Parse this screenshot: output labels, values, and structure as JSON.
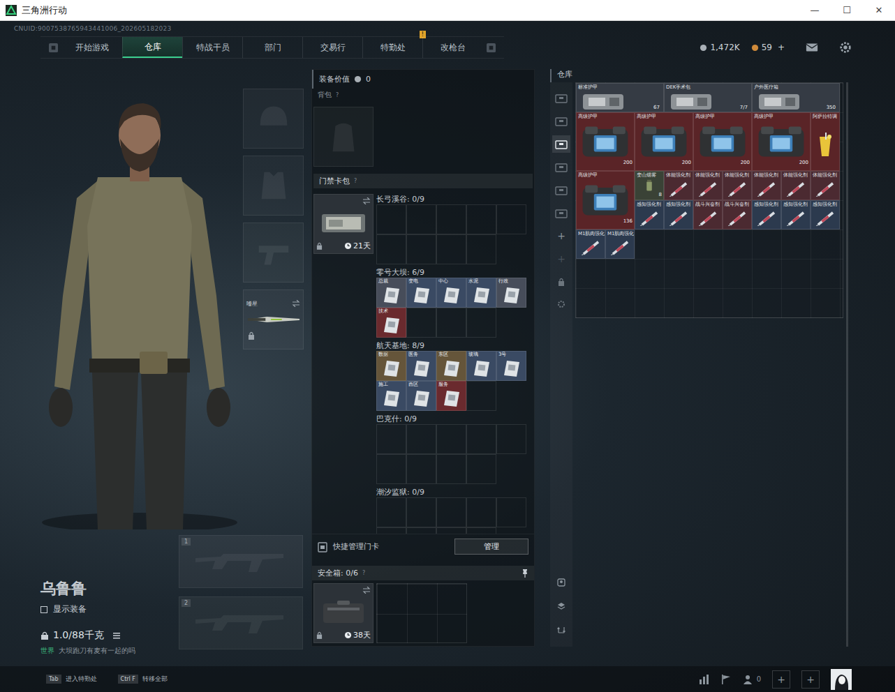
{
  "window": {
    "title": "三角洲行动",
    "controls": [
      "—",
      "☐",
      "✕"
    ]
  },
  "uid": "CNUID:9007538765943441006_202605182023",
  "nav": {
    "tabs": [
      {
        "label": "开始游戏",
        "selected": false,
        "badge": ""
      },
      {
        "label": "仓库",
        "selected": true,
        "badge": ""
      },
      {
        "label": "特战干员",
        "selected": false,
        "badge": ""
      },
      {
        "label": "部门",
        "selected": false,
        "badge": ""
      },
      {
        "label": "交易行",
        "selected": false,
        "badge": ""
      },
      {
        "label": "特勤处",
        "selected": false,
        "badge": "!"
      },
      {
        "label": "改枪台",
        "selected": false,
        "badge": ""
      }
    ],
    "currency": [
      {
        "kind": "coin",
        "amount": "1,472K",
        "add": ""
      },
      {
        "kind": "bond",
        "amount": "59",
        "add": "+"
      }
    ]
  },
  "character": {
    "name": "乌鲁鲁",
    "show_gear": {
      "label": "显示装备",
      "checked": false
    },
    "weight": "1.0/88千克",
    "chat": {
      "channel": "世界",
      "message": "大坝跑刀有麦有一起的吗"
    }
  },
  "gear_slots": [
    {
      "kind": "helmet",
      "label": "",
      "locked": false
    },
    {
      "kind": "armor",
      "label": "",
      "locked": false
    },
    {
      "kind": "pistol",
      "label": "",
      "locked": false
    },
    {
      "kind": "melee",
      "label": "嗜星",
      "locked": true
    }
  ],
  "weapon_slots": [
    {
      "number": "1"
    },
    {
      "number": "2"
    }
  ],
  "loadout": {
    "value_label": "装备价值",
    "value": "0",
    "backpack": {
      "label": "背包",
      "help": "?"
    },
    "keycard": {
      "label": "门禁卡包",
      "help": "?",
      "days": "21天",
      "locked": true
    },
    "maps": [
      {
        "title": "长弓溪谷: 0/9",
        "cards": []
      },
      {
        "title": "零号大坝: 6/9",
        "cards": [
          {
            "label": "总裁",
            "color": "#474d5a"
          },
          {
            "label": "变电",
            "color": "#3a4a63"
          },
          {
            "label": "中心",
            "color": "#3a4a63"
          },
          {
            "label": "水泥",
            "color": "#3a4a63"
          },
          {
            "label": "行政",
            "color": "#474d5a"
          },
          {
            "label": "技术",
            "color": "#6a2a2e"
          }
        ]
      },
      {
        "title": "航天基地: 8/9",
        "cards": [
          {
            "label": "数据",
            "color": "#65553a"
          },
          {
            "label": "医务",
            "color": "#3a4a63"
          },
          {
            "label": "东区",
            "color": "#65553a"
          },
          {
            "label": "玻璃",
            "color": "#3a4a63"
          },
          {
            "label": "3号",
            "color": "#3a4a63"
          },
          {
            "label": "施工",
            "color": "#3a4a63"
          },
          {
            "label": "西区",
            "color": "#3a4a63"
          },
          {
            "label": "服务",
            "color": "#6a2a2e"
          }
        ]
      },
      {
        "title": "巴克什: 0/9",
        "cards": []
      },
      {
        "title": "潮汐监狱: 0/9",
        "cards": []
      }
    ],
    "quick_manage": "快捷管理门卡",
    "manage": "管理",
    "safe": {
      "label": "安全箱: 0/6",
      "help": "?",
      "days": "38天",
      "locked": true
    }
  },
  "warehouse": {
    "title": "仓库",
    "tabs": [
      {
        "selected": false
      },
      {
        "selected": false
      },
      {
        "selected": true
      },
      {
        "selected": false
      },
      {
        "selected": false
      },
      {
        "selected": false
      }
    ],
    "actions": [
      "+",
      "+"
    ],
    "items": [
      {
        "name": "标准护甲",
        "count": "67",
        "kind": "wide",
        "color": "#353b44"
      },
      {
        "name": "DEK手术包",
        "count": "7/7",
        "kind": "wide",
        "color": "#353b44"
      },
      {
        "name": "户外医疗箱",
        "count": "350",
        "kind": "wide",
        "color": "#353b44"
      },
      {
        "name": "高级护甲",
        "count": "200",
        "kind": "armor",
        "color": "#5a2427"
      },
      {
        "name": "高级护甲",
        "count": "200",
        "kind": "armor",
        "color": "#5a2427"
      },
      {
        "name": "高级护甲",
        "count": "200",
        "kind": "armor",
        "color": "#5a2427"
      },
      {
        "name": "高级护甲",
        "count": "200",
        "kind": "armor",
        "color": "#5a2427"
      },
      {
        "name": "阿萨拉特调",
        "count": "",
        "kind": "tall",
        "color": "#5a2427"
      },
      {
        "name": "高级护甲",
        "count": "136",
        "kind": "armor",
        "color": "#5a2427"
      },
      {
        "name": "变山烟雾",
        "count": "8",
        "kind": "grenade",
        "color": "#3a4236"
      },
      {
        "name": "体能强化剂",
        "count": "",
        "kind": "small",
        "color": "#4b2a31"
      },
      {
        "name": "体能强化剂",
        "count": "",
        "kind": "small",
        "color": "#4b2a31"
      },
      {
        "name": "体能强化剂",
        "count": "",
        "kind": "small",
        "color": "#4b2a31"
      },
      {
        "name": "体能强化剂",
        "count": "",
        "kind": "small",
        "color": "#4b2a31"
      },
      {
        "name": "体能强化剂",
        "count": "",
        "kind": "small",
        "color": "#4b2a31"
      },
      {
        "name": "体能强化剂",
        "count": "",
        "kind": "small",
        "color": "#4b2a31"
      },
      {
        "name": "感知强化剂",
        "count": "",
        "kind": "small",
        "color": "#2c3a4e"
      },
      {
        "name": "感知强化剂",
        "count": "",
        "kind": "small",
        "color": "#2c3a4e"
      },
      {
        "name": "战斗兴奋剂",
        "count": "",
        "kind": "small",
        "color": "#4b2a31"
      },
      {
        "name": "战斗兴奋剂",
        "count": "",
        "kind": "small",
        "color": "#4b2a31"
      },
      {
        "name": "感知强化剂",
        "count": "",
        "kind": "small",
        "color": "#2c3a4e"
      },
      {
        "name": "感知强化剂",
        "count": "",
        "kind": "small",
        "color": "#2c3a4e"
      },
      {
        "name": "感知强化剂",
        "count": "",
        "kind": "small",
        "color": "#2c3a4e"
      },
      {
        "name": "M1肌肉强化",
        "count": "",
        "kind": "small",
        "color": "#2c3a4e"
      },
      {
        "name": "M1肌肉强化",
        "count": "",
        "kind": "small",
        "color": "#2c3a4e"
      }
    ]
  },
  "bottom_bar": {
    "hints": [
      {
        "key": "Tab",
        "label": "进入特勤处"
      },
      {
        "key": "Ctrl F",
        "label": "转移全部"
      }
    ],
    "friends": "0",
    "invite_slots": [
      "+",
      "+"
    ]
  }
}
